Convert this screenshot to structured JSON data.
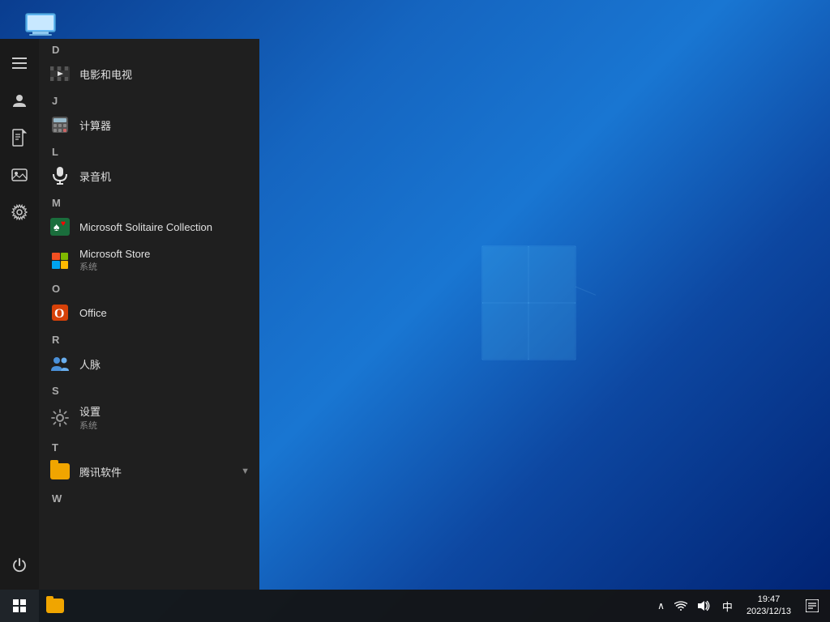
{
  "desktop": {
    "icon_label": "此电脑"
  },
  "start_menu": {
    "sections": [
      {
        "letter": "D",
        "apps": [
          {
            "name": "电影和电视",
            "icon_type": "film",
            "sub": ""
          }
        ]
      },
      {
        "letter": "J",
        "apps": [
          {
            "name": "计算器",
            "icon_type": "calc",
            "sub": ""
          }
        ]
      },
      {
        "letter": "L",
        "apps": [
          {
            "name": "录音机",
            "icon_type": "mic",
            "sub": ""
          }
        ]
      },
      {
        "letter": "M",
        "apps": [
          {
            "name": "Microsoft Solitaire Collection",
            "icon_type": "solitaire",
            "sub": ""
          },
          {
            "name": "Microsoft Store",
            "icon_type": "store",
            "sub": "系统"
          }
        ]
      },
      {
        "letter": "O",
        "apps": [
          {
            "name": "Office",
            "icon_type": "office",
            "sub": ""
          }
        ]
      },
      {
        "letter": "R",
        "apps": [
          {
            "name": "人脉",
            "icon_type": "renmai",
            "sub": ""
          }
        ]
      },
      {
        "letter": "S",
        "apps": [
          {
            "name": "设置",
            "icon_type": "settings",
            "sub": "系统"
          }
        ]
      },
      {
        "letter": "T",
        "apps": [
          {
            "name": "腾讯软件",
            "icon_type": "tencent",
            "sub": "",
            "expandable": true
          }
        ]
      },
      {
        "letter": "W",
        "apps": []
      }
    ],
    "sidebar_items": [
      {
        "name": "hamburger",
        "label": "菜单"
      },
      {
        "name": "user",
        "label": "用户"
      },
      {
        "name": "document",
        "label": "文档"
      },
      {
        "name": "photos",
        "label": "图片"
      },
      {
        "name": "settings",
        "label": "设置"
      },
      {
        "name": "power",
        "label": "电源"
      }
    ]
  },
  "taskbar": {
    "start_label": "开始",
    "clock": {
      "time": "19:47",
      "date": "2023/12/13"
    },
    "tray": {
      "language": "中",
      "volume_label": "音量",
      "network_label": "网络"
    },
    "taskbar_items": [
      {
        "name": "文件资源管理器",
        "icon_type": "folder"
      }
    ]
  }
}
